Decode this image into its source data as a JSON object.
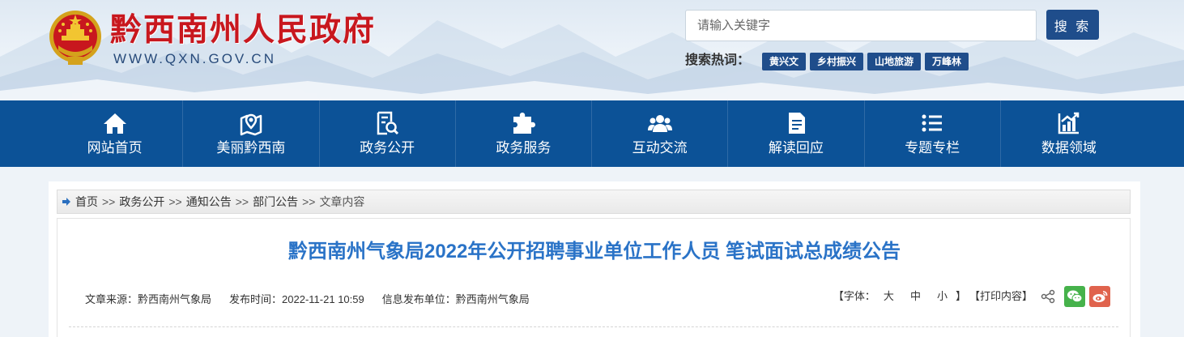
{
  "header": {
    "site_title": "黔西南州人民政府",
    "site_domain": "WWW.QXN.GOV.CN",
    "search": {
      "placeholder": "请输入关键字",
      "button_label": "搜 索"
    },
    "hot_search": {
      "label": "搜索热词：",
      "tags": [
        "黄兴文",
        "乡村振兴",
        "山地旅游",
        "万峰林"
      ]
    }
  },
  "nav": {
    "items": [
      {
        "label": "网站首页",
        "icon": "home-icon"
      },
      {
        "label": "美丽黔西南",
        "icon": "map-pin-icon"
      },
      {
        "label": "政务公开",
        "icon": "document-search-icon"
      },
      {
        "label": "政务服务",
        "icon": "puzzle-icon"
      },
      {
        "label": "互动交流",
        "icon": "people-icon"
      },
      {
        "label": "解读回应",
        "icon": "file-icon"
      },
      {
        "label": "专题专栏",
        "icon": "list-icon"
      },
      {
        "label": "数据领域",
        "icon": "chart-icon"
      }
    ]
  },
  "breadcrumb": {
    "items": [
      "首页",
      "政务公开",
      "通知公告",
      "部门公告"
    ],
    "separator": ">>",
    "current": "文章内容"
  },
  "article": {
    "title": "黔西南州气象局2022年公开招聘事业单位工作人员 笔试面试总成绩公告",
    "meta": {
      "source_label": "文章来源：",
      "source_value": "黔西南州气象局",
      "time_label": "发布时间：",
      "time_value": "2022-11-21 10:59",
      "publisher_label": "信息发布单位：",
      "publisher_value": "黔西南州气象局"
    },
    "tools": {
      "font_prefix": "【字体：",
      "font_large": "大",
      "font_medium": "中",
      "font_small": "小",
      "font_suffix": "】",
      "print_label": "【打印内容】"
    }
  },
  "colors": {
    "nav_bg": "#0c5297",
    "title_red": "#c8171e",
    "article_title": "#2a73c7",
    "wechat_green": "#46b24b",
    "weibo_red": "#e0634d"
  }
}
